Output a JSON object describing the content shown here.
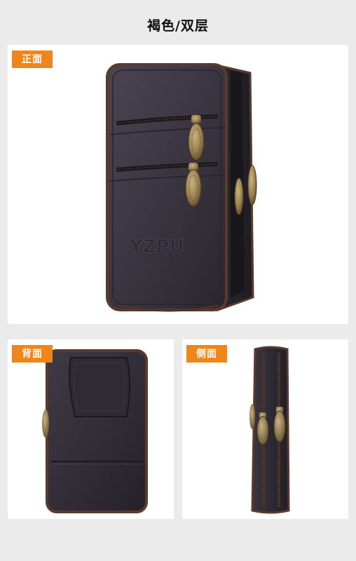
{
  "title": "褐色/双层",
  "views": [
    {
      "label": "正面"
    },
    {
      "label": "背面"
    },
    {
      "label": "侧面"
    }
  ],
  "product": {
    "logo_text": "YZPU",
    "colors": {
      "leather": "#3b3640",
      "leather_dark": "#25212a",
      "piping": "#5a3a2c",
      "zipper_metal": "#9a8150",
      "accent": "#f08519"
    }
  }
}
